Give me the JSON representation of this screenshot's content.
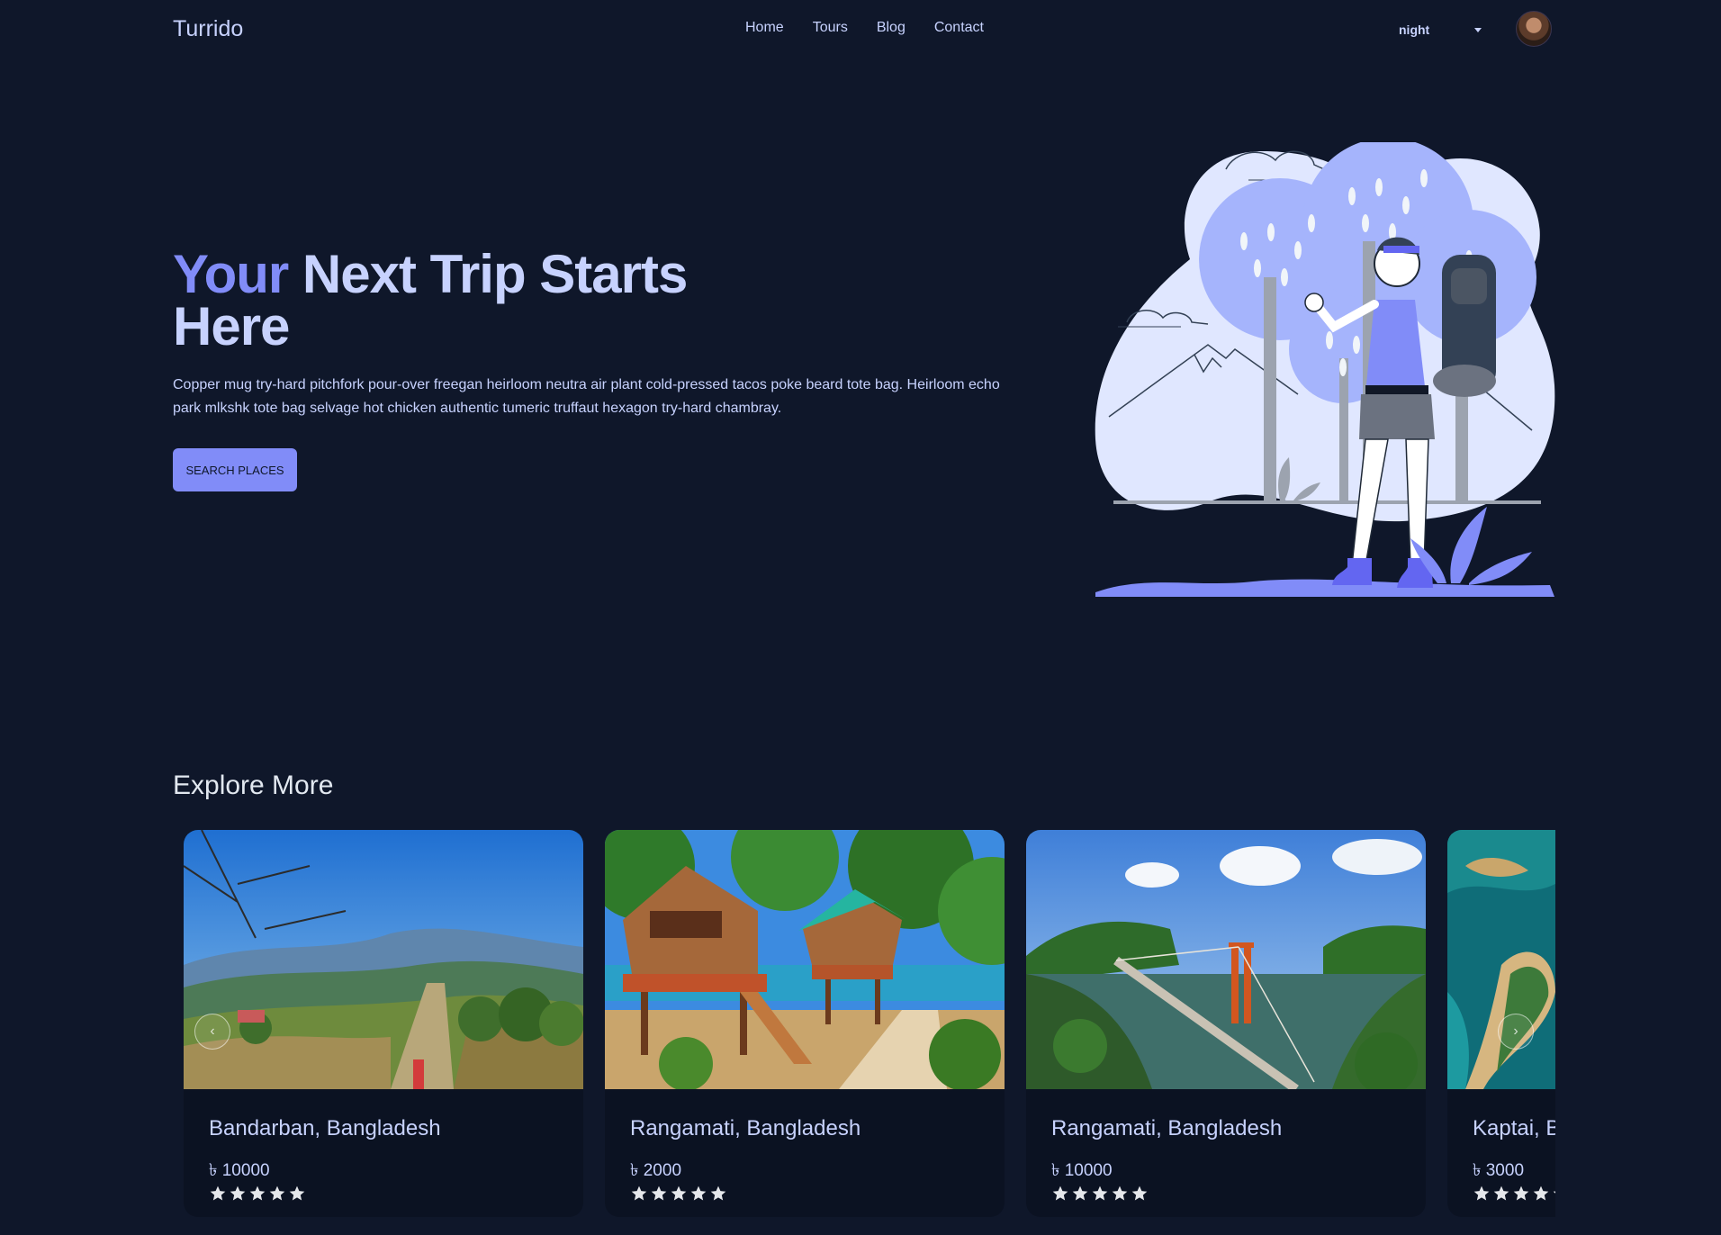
{
  "navbar": {
    "brand": "Turrido",
    "links": [
      "Home",
      "Tours",
      "Blog",
      "Contact"
    ],
    "theme": "night"
  },
  "hero": {
    "title_accent": "Your",
    "title_rest": " Next Trip Starts Here",
    "description": "Copper mug try-hard pitchfork pour-over freegan heirloom neutra air plant cold-pressed tacos poke beard tote bag. Heirloom echo park mlkshk tote bag selvage hot chicken authentic tumeric truffaut hexagon try-hard chambray.",
    "button": "SEARCH PLACES"
  },
  "explore": {
    "title": "Explore More",
    "cards": [
      {
        "title": "Bandarban, Bangladesh",
        "price": "৳ 10000",
        "rating": 5
      },
      {
        "title": "Rangamati, Bangladesh",
        "price": "৳ 2000",
        "rating": 5
      },
      {
        "title": "Rangamati, Bangladesh",
        "price": "৳ 10000",
        "rating": 5
      },
      {
        "title": "Kaptai, Bangladesh",
        "price": "৳ 3000",
        "rating": 5
      }
    ]
  },
  "colors": {
    "background": "#0f172a",
    "accent": "#818cf8",
    "text": "#c7d2fe",
    "card": "#0b1222"
  }
}
